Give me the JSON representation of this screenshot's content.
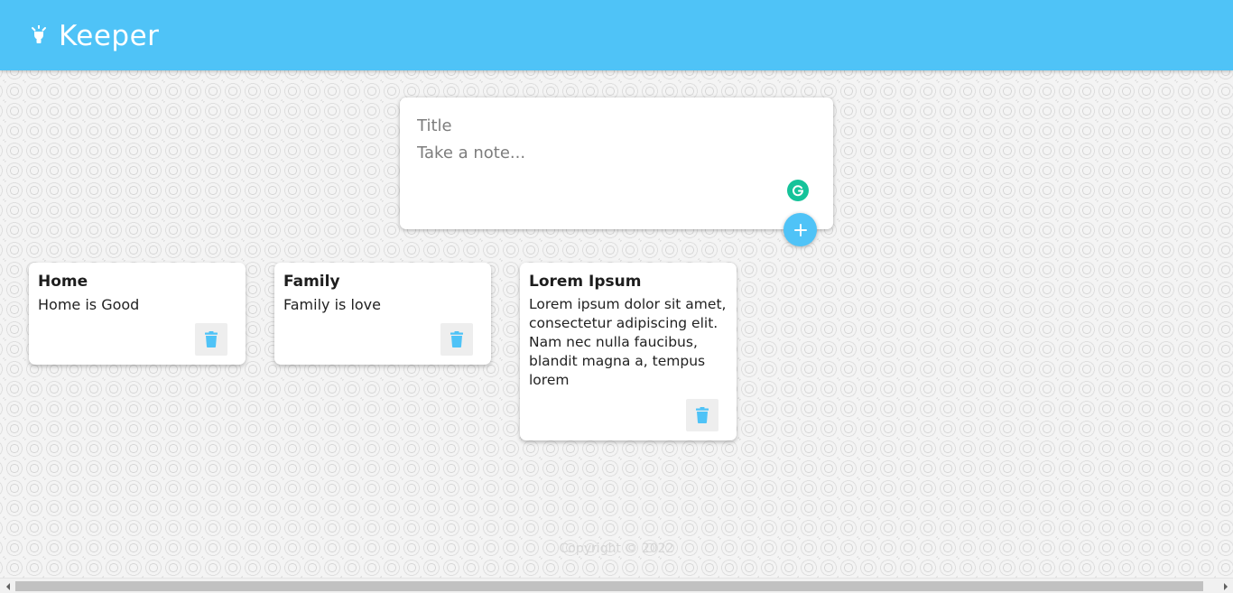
{
  "app": {
    "title": "Keeper",
    "logo_icon": "lightbulb-icon",
    "accent_color": "#4fc3f7"
  },
  "create_note": {
    "title_placeholder": "Title",
    "content_placeholder": "Take a note...",
    "add_icon": "plus-icon",
    "grammarly_icon": "grammarly-icon",
    "grammarly_color": "#15c39a"
  },
  "notes": [
    {
      "title": "Home",
      "content": "Home is Good",
      "delete_icon": "trash-icon"
    },
    {
      "title": "Family",
      "content": "Family is love",
      "delete_icon": "trash-icon"
    },
    {
      "title": "Lorem Ipsum",
      "content": "Lorem ipsum dolor sit amet, consectetur adipiscing elit. Nam nec nulla faucibus, blandit magna a, tempus lorem",
      "delete_icon": "trash-icon"
    }
  ],
  "footer": {
    "copyright": "Copyright © 2022"
  }
}
